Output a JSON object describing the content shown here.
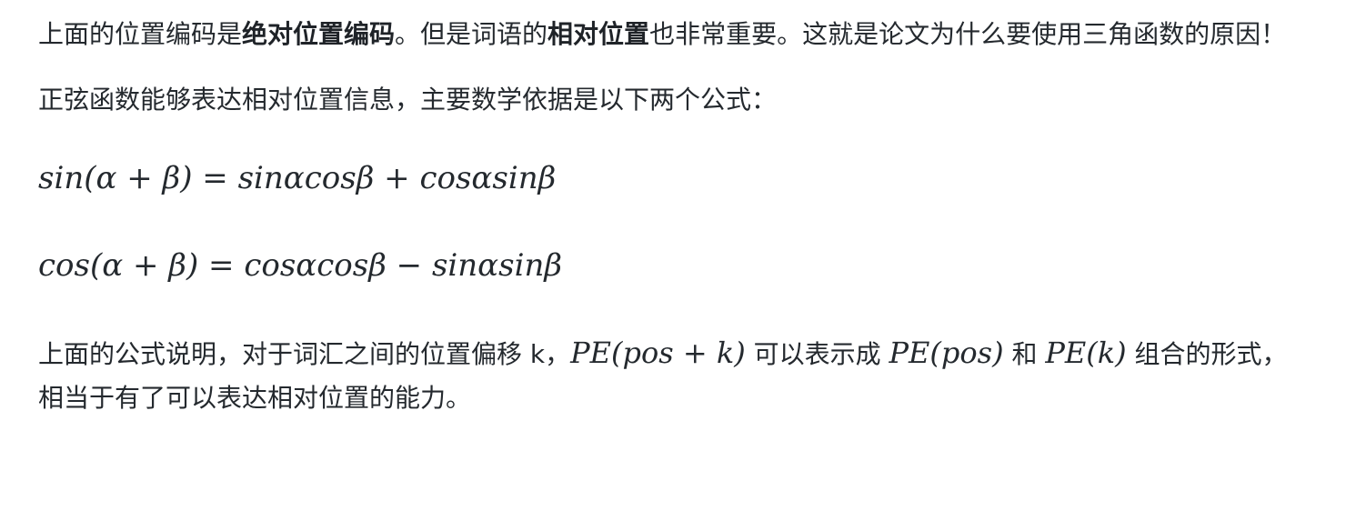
{
  "p1": {
    "t1": "上面的位置编码是",
    "b1": "绝对位置编码",
    "t2": "。但是词语的",
    "b2": "相对位置",
    "t3": "也非常重要。这就是论文为什么要使用三角函数的原因！"
  },
  "p2": {
    "text": "正弦函数能够表达相对位置信息，主要数学依据是以下两个公式："
  },
  "formulas": {
    "sin_sum": "sin(α + β) = sinαcosβ + cosαsinβ",
    "cos_sum": "cos(α + β) = cosαcosβ − sinαsinβ"
  },
  "p3": {
    "t1": "上面的公式说明，对于词汇之间的位置偏移 k，",
    "m1": "PE(pos + k)",
    "t2": " 可以表示成 ",
    "m2": "PE(pos)",
    "t3": " 和 ",
    "m3": "PE(k)",
    "t4": " 组合的形式，相当于有了可以表达相对位置的能力。"
  }
}
